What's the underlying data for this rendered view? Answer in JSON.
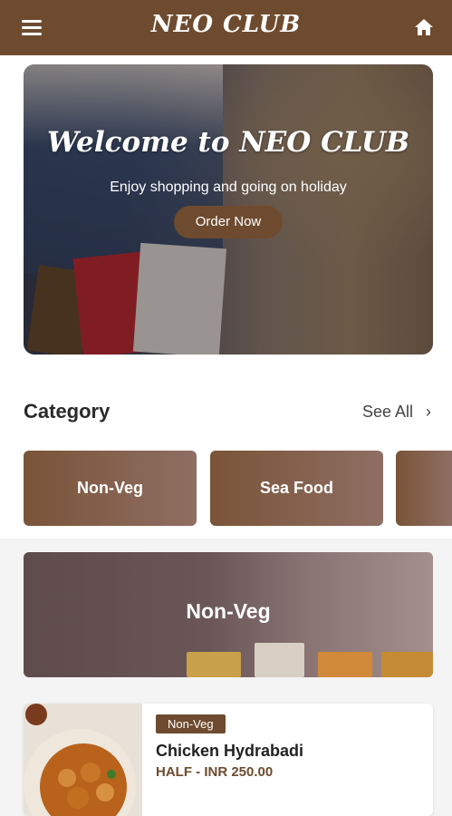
{
  "header": {
    "title": "NEO CLUB",
    "menu_icon": "hamburger-menu-icon",
    "home_icon": "home-icon",
    "bar_color": "#6e4b2e"
  },
  "hero": {
    "title": "Welcome to NEO CLUB",
    "subtitle": "Enjoy shopping and going on holiday",
    "cta_label": "Order Now"
  },
  "category": {
    "heading": "Category",
    "see_all_label": "See All",
    "see_all_icon": "chevron-right-icon",
    "items": [
      {
        "label": "Non-Veg"
      },
      {
        "label": "Sea Food"
      }
    ]
  },
  "banner": {
    "title": "Non-Veg"
  },
  "product": {
    "badge": "Non-Veg",
    "name": "Chicken Hydrabadi",
    "price": "HALF - INR 250.00"
  }
}
